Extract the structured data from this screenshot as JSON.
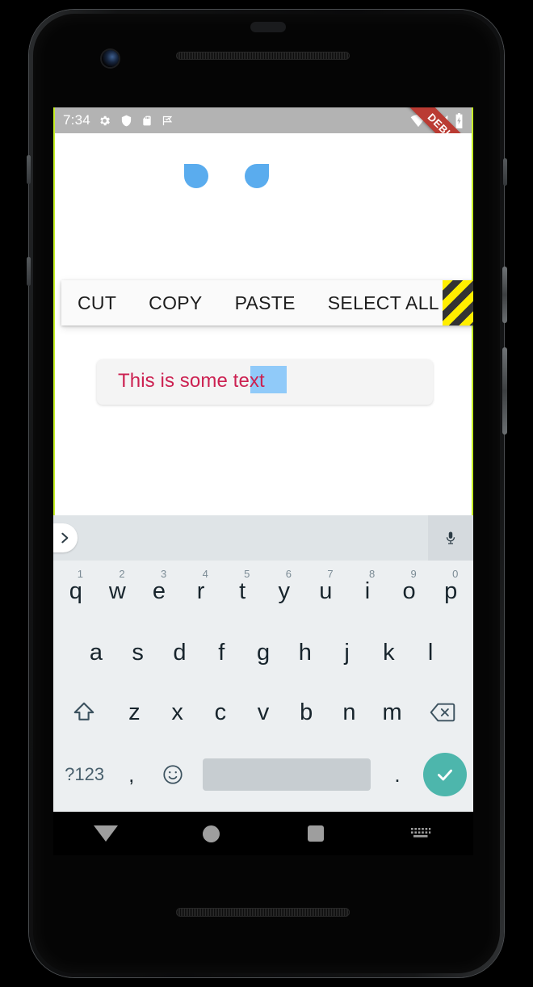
{
  "device": {
    "name": "android-phone-mockup",
    "hardware": {
      "earpiece": "earpiece-speaker",
      "front_camera": "front-camera",
      "bottom_speaker": "bottom-speaker"
    }
  },
  "status_bar": {
    "time": "7:34",
    "left_icons": [
      "gear-icon",
      "shield-icon",
      "sd-card-icon",
      "flag-check-icon"
    ],
    "right_icons": [
      "wifi-icon",
      "signal-icon",
      "battery-charging-icon"
    ],
    "background": "#b3b3b3"
  },
  "debug_banner": {
    "label": "DEBUG",
    "color": "#ba3b33"
  },
  "context_menu": {
    "items": [
      {
        "label": "CUT",
        "name": "cut"
      },
      {
        "label": "COPY",
        "name": "copy"
      },
      {
        "label": "PASTE",
        "name": "paste"
      },
      {
        "label": "SELECT ALL",
        "name": "select-all"
      }
    ],
    "overflow_indicator": "overflow-stripes"
  },
  "text_field": {
    "full_text": "This is some text",
    "text_before_selection": "This is some ",
    "selected_text": "text",
    "text_color": "#cc2151",
    "selection_highlight_color": "#90caf9",
    "handle_color": "#5aacee",
    "background": "#f4f4f4"
  },
  "keyboard": {
    "suggestion_bar": {
      "expand_icon": "chevron-right-icon",
      "mic_icon": "microphone-icon"
    },
    "row1": [
      {
        "letter": "q",
        "num": "1"
      },
      {
        "letter": "w",
        "num": "2"
      },
      {
        "letter": "e",
        "num": "3"
      },
      {
        "letter": "r",
        "num": "4"
      },
      {
        "letter": "t",
        "num": "5"
      },
      {
        "letter": "y",
        "num": "6"
      },
      {
        "letter": "u",
        "num": "7"
      },
      {
        "letter": "i",
        "num": "8"
      },
      {
        "letter": "o",
        "num": "9"
      },
      {
        "letter": "p",
        "num": "0"
      }
    ],
    "row2": [
      {
        "letter": "a"
      },
      {
        "letter": "s"
      },
      {
        "letter": "d"
      },
      {
        "letter": "f"
      },
      {
        "letter": "g"
      },
      {
        "letter": "h"
      },
      {
        "letter": "j"
      },
      {
        "letter": "k"
      },
      {
        "letter": "l"
      }
    ],
    "row3": {
      "shift_icon": "shift-icon",
      "letters": [
        {
          "letter": "z"
        },
        {
          "letter": "x"
        },
        {
          "letter": "c"
        },
        {
          "letter": "v"
        },
        {
          "letter": "b"
        },
        {
          "letter": "n"
        },
        {
          "letter": "m"
        }
      ],
      "backspace_icon": "backspace-icon"
    },
    "row4": {
      "symbols_label": "?123",
      "comma_label": ",",
      "emoji_icon": "emoji-smiley-icon",
      "space_label": "",
      "period_label": ".",
      "enter_icon": "checkmark-icon",
      "enter_color": "#4db6ac"
    }
  },
  "nav_bar": {
    "back_icon": "back-triangle-icon",
    "home_icon": "home-circle-icon",
    "recents_icon": "recents-square-icon",
    "keyboard_icon": "keyboard-icon"
  }
}
